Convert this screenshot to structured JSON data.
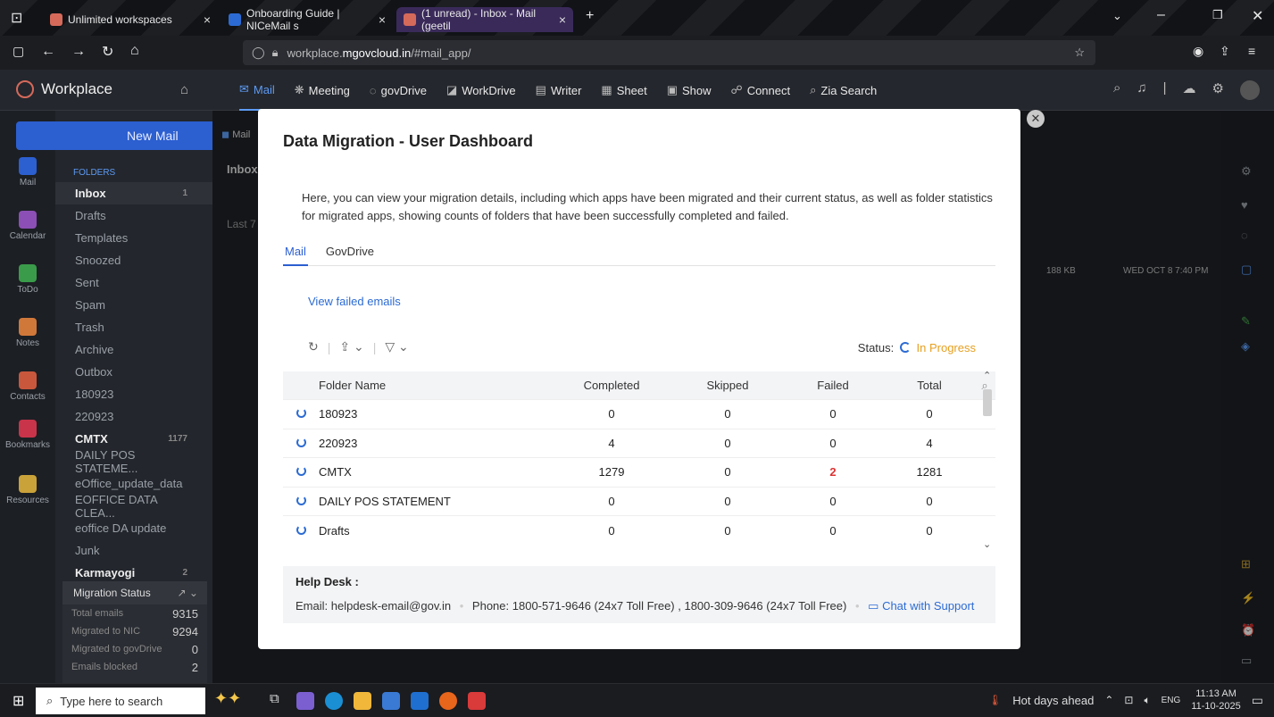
{
  "browser": {
    "tabs": [
      {
        "title": "Unlimited workspaces",
        "color": "#d56a5b"
      },
      {
        "title": "Onboarding Guide | NICeMail s",
        "color": "#2c6bd3"
      },
      {
        "title": "(1 unread) - Inbox - Mail (geetil",
        "color": "#d56a5b"
      }
    ],
    "url_prefix": "workplace.",
    "url_domain": "mgovcloud.in",
    "url_path": "/#mail_app/"
  },
  "app": {
    "brand": "Workplace",
    "nav": [
      "Mail",
      "Meeting",
      "govDrive",
      "WorkDrive",
      "Writer",
      "Sheet",
      "Show",
      "Connect",
      "Zia Search"
    ]
  },
  "rail": [
    "Mail",
    "Calendar",
    "ToDo",
    "Notes",
    "Contacts",
    "Bookmarks",
    "Resources"
  ],
  "folders": {
    "new_mail": "New Mail",
    "header": "FOLDERS",
    "items": [
      {
        "name": "Inbox",
        "count": "1"
      },
      {
        "name": "Drafts",
        "count": ""
      },
      {
        "name": "Templates",
        "count": ""
      },
      {
        "name": "Snoozed",
        "count": ""
      },
      {
        "name": "Sent",
        "count": ""
      },
      {
        "name": "Spam",
        "count": ""
      },
      {
        "name": "Trash",
        "count": ""
      },
      {
        "name": "Archive",
        "count": ""
      },
      {
        "name": "Outbox",
        "count": ""
      },
      {
        "name": "180923",
        "count": ""
      },
      {
        "name": "220923",
        "count": ""
      },
      {
        "name": "CMTX",
        "count": "1177"
      },
      {
        "name": "DAILY POS STATEME...",
        "count": ""
      },
      {
        "name": "eOffice_update_data",
        "count": ""
      },
      {
        "name": "EOFFICE DATA CLEA...",
        "count": ""
      },
      {
        "name": "eoffice DA update",
        "count": ""
      },
      {
        "name": "Junk",
        "count": ""
      },
      {
        "name": "Karmayogi",
        "count": "2"
      }
    ],
    "migration": {
      "title": "Migration Status",
      "rows": [
        {
          "label": "Total emails",
          "value": "9315"
        },
        {
          "label": "Migrated to NIC",
          "value": "9294"
        },
        {
          "label": "Migrated to govDrive",
          "value": "0"
        },
        {
          "label": "Emails blocked",
          "value": "2"
        }
      ]
    }
  },
  "maillist": {
    "tab": "Mail",
    "title": "Inbox",
    "group": "Last 7",
    "size": "188 KB",
    "date": "WED OCT 8 7:40 PM"
  },
  "modal": {
    "title": "Data Migration - User Dashboard",
    "description": "Here, you can view your migration details, including which apps have been migrated and their current status, as well as folder statistics for migrated apps, showing counts of folders that have been successfully completed and failed.",
    "tabs": [
      "Mail",
      "GovDrive"
    ],
    "view_failed": "View failed emails",
    "status_label": "Status:",
    "status_value": "In Progress",
    "columns": [
      "Folder Name",
      "Completed",
      "Skipped",
      "Failed",
      "Total"
    ],
    "rows": [
      {
        "name": "180923",
        "completed": "0",
        "skipped": "0",
        "failed": "0",
        "total": "0"
      },
      {
        "name": "220923",
        "completed": "4",
        "skipped": "0",
        "failed": "0",
        "total": "4"
      },
      {
        "name": "CMTX",
        "completed": "1279",
        "skipped": "0",
        "failed": "2",
        "total": "1281"
      },
      {
        "name": "DAILY POS STATEMENT",
        "completed": "0",
        "skipped": "0",
        "failed": "0",
        "total": "0"
      },
      {
        "name": "Drafts",
        "completed": "0",
        "skipped": "0",
        "failed": "0",
        "total": "0"
      }
    ],
    "helpdesk": {
      "title": "Help Desk :",
      "email_label": "Email:",
      "email": "helpdesk-email@gov.in",
      "phone_label": "Phone:",
      "phone": "1800-571-9646 (24x7 Toll Free) , 1800-309-9646 (24x7 Toll Free)",
      "chat": "Chat with Support"
    }
  },
  "taskbar": {
    "search_placeholder": "Type here to search",
    "weather": "Hot days ahead",
    "lang": "ENG",
    "time": "11:13 AM",
    "date": "11-10-2025"
  }
}
